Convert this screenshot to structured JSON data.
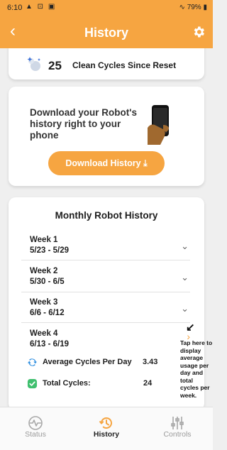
{
  "status_bar": {
    "time": "6:10",
    "battery": "79%"
  },
  "header": {
    "title": "History"
  },
  "summary": {
    "clean_cycles_count": "25",
    "clean_cycles_label": "Clean Cycles Since Reset"
  },
  "download": {
    "text": "Download your Robot's history right to your phone",
    "button_label": "Download History"
  },
  "monthly": {
    "title": "Monthly Robot History",
    "weeks": [
      {
        "name": "Week 1",
        "dates": "5/23 - 5/29"
      },
      {
        "name": "Week 2",
        "dates": "5/30 - 6/5"
      },
      {
        "name": "Week 3",
        "dates": "6/6 - 6/12"
      },
      {
        "name": "Week 4",
        "dates": "6/13 - 6/19"
      }
    ],
    "stats": {
      "average_label": "Average Cycles Per Day",
      "average_value": "3.43",
      "total_label": "Total Cycles:",
      "total_value": "24"
    },
    "hint": "Tap here to display average usage per day and total cycles per week."
  },
  "bottom_nav": {
    "items": [
      {
        "label": "Status",
        "icon": "pulse-icon"
      },
      {
        "label": "History",
        "icon": "history-icon"
      },
      {
        "label": "Controls",
        "icon": "sliders-icon"
      }
    ],
    "active": "History"
  },
  "colors": {
    "accent": "#f6a541",
    "background": "#efefef",
    "sync_blue": "#2f8fe0",
    "check_green": "#3fbf6e"
  }
}
